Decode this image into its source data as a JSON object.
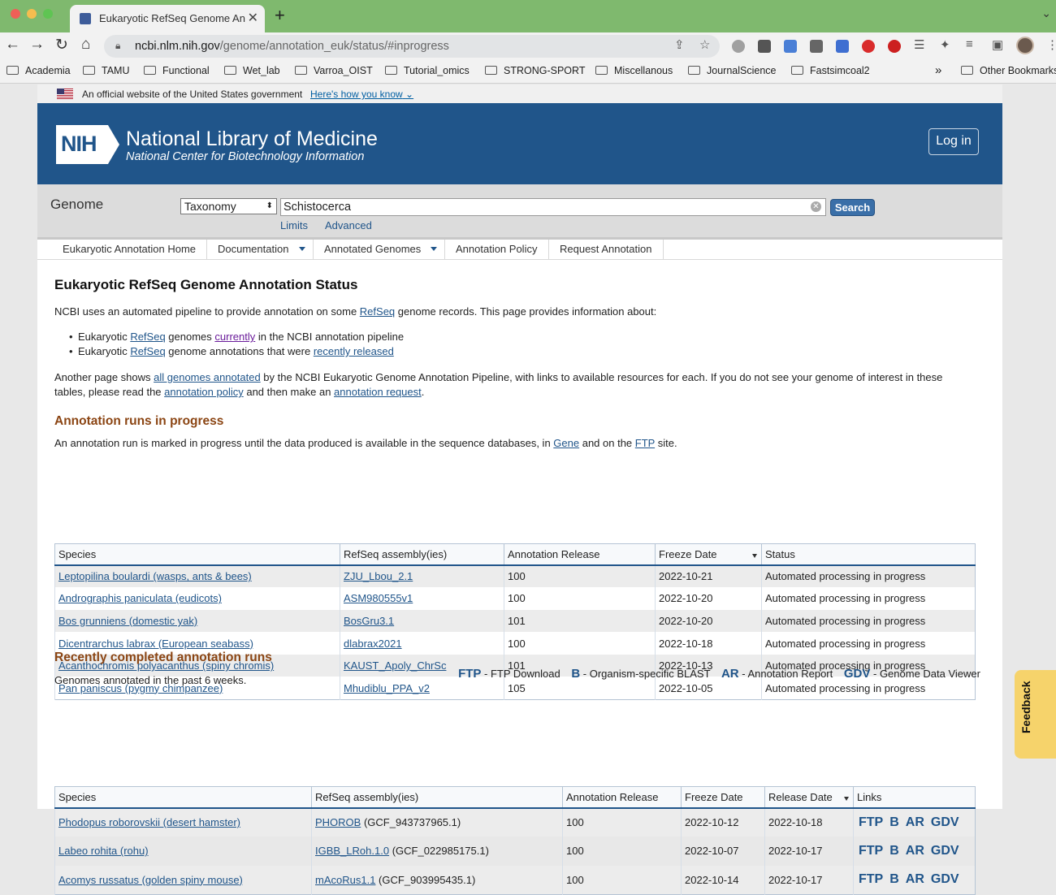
{
  "browser": {
    "tab_title": "Eukaryotic RefSeq Genome An",
    "url_host": "ncbi.nlm.nih.gov",
    "url_path": "/genome/annotation_euk/status/#inprogress",
    "bookmarks": [
      "Academia",
      "TAMU",
      "Functional",
      "Wet_lab",
      "Varroa_OIST",
      "Tutorial_omics",
      "STRONG-SPORT",
      "Miscellanous",
      "JournalScience",
      "Fastsimcoal2"
    ],
    "bookmarks_overflow": "»",
    "other_bookmarks": "Other Bookmarks"
  },
  "gov_banner": {
    "text": "An official website of the United States government",
    "link": "Here's how you know"
  },
  "header": {
    "logo": "NIH",
    "title": "National Library of Medicine",
    "subtitle": "National Center for Biotechnology Information",
    "login": "Log in"
  },
  "search": {
    "db_title": "Genome",
    "db_selected": "Taxonomy",
    "term": "Schistocerca",
    "button": "Search",
    "limits": "Limits",
    "advanced": "Advanced"
  },
  "menu": [
    "Eukaryotic Annotation Home",
    "Documentation",
    "Annotated Genomes",
    "Annotation Policy",
    "Request Annotation"
  ],
  "main": {
    "title": "Eukaryotic RefSeq Genome Annotation Status",
    "intro_a": "NCBI uses an automated pipeline to provide annotation on some ",
    "intro_link": "RefSeq",
    "intro_b": " genome records. This page provides information about:",
    "bullet1_a": "Eukaryotic ",
    "bullet1_link1": "RefSeq",
    "bullet1_b": " genomes ",
    "bullet1_link2": "currently",
    "bullet1_c": " in the NCBI annotation pipeline",
    "bullet2_a": "Eukaryotic ",
    "bullet2_link1": "RefSeq",
    "bullet2_b": " genome annotations that were ",
    "bullet2_link2": "recently released",
    "another_a": "Another page shows ",
    "another_link1": "all genomes annotated",
    "another_b": " by the NCBI Eukaryotic Genome Annotation Pipeline, with links to available resources for each. If you do not see your genome of interest in these tables, please read the ",
    "another_link2": "annotation policy",
    "another_c": " and then make an ",
    "another_link3": "annotation request",
    "another_d": "."
  },
  "inprogress": {
    "heading": "Annotation runs in progress",
    "desc_a": "An annotation run is marked in progress until the data produced is available in the sequence databases, in ",
    "desc_link1": "Gene",
    "desc_b": " and on the ",
    "desc_link2": "FTP",
    "desc_c": " site.",
    "columns": [
      "Species",
      "RefSeq assembly(ies)",
      "Annotation Release",
      "Freeze Date",
      "Status"
    ],
    "rows": [
      [
        "Leptopilina boulardi (wasps, ants & bees)",
        "ZJU_Lbou_2.1",
        "100",
        "2022-10-21",
        "Automated processing in progress"
      ],
      [
        "Andrographis paniculata (eudicots)",
        "ASM980555v1",
        "100",
        "2022-10-20",
        "Automated processing in progress"
      ],
      [
        "Bos grunniens (domestic yak)",
        "BosGru3.1",
        "101",
        "2022-10-20",
        "Automated processing in progress"
      ],
      [
        "Dicentrarchus labrax (European seabass)",
        "dlabrax2021",
        "100",
        "2022-10-18",
        "Automated processing in progress"
      ],
      [
        "Acanthochromis polyacanthus (spiny chromis)",
        "KAUST_Apoly_ChrSc",
        "101",
        "2022-10-13",
        "Automated processing in progress"
      ],
      [
        "Pan paniscus (pygmy chimpanzee)",
        "Mhudiblu_PPA_v2",
        "105",
        "2022-10-05",
        "Automated processing in progress"
      ]
    ]
  },
  "completed": {
    "heading": "Recently completed annotation runs",
    "desc": "Genomes annotated in the past 6 weeks.",
    "legend": [
      {
        "code": "FTP",
        "label": " - FTP Download"
      },
      {
        "code": "B",
        "label": " - Organism-specific BLAST"
      },
      {
        "code": "AR",
        "label": " - Annotation Report"
      },
      {
        "code": "GDV",
        "label": " - Genome Data Viewer"
      }
    ],
    "columns": [
      "Species",
      "RefSeq assembly(ies)",
      "Annotation Release",
      "Freeze Date",
      "Release Date",
      "Links"
    ],
    "rows": [
      [
        "Phodopus roborovskii (desert hamster)",
        "PHOROB",
        "(GCF_943737965.1)",
        "100",
        "2022-10-12",
        "2022-10-18"
      ],
      [
        "Labeo rohita (rohu)",
        "IGBB_LRoh.1.0",
        "(GCF_022985175.1)",
        "100",
        "2022-10-07",
        "2022-10-17"
      ],
      [
        "Acomys russatus (golden spiny mouse)",
        "mAcoRus1.1",
        "(GCF_903995435.1)",
        "100",
        "2022-10-14",
        "2022-10-17"
      ]
    ],
    "links": [
      "FTP",
      "B",
      "AR",
      "GDV"
    ]
  },
  "feedback": "Feedback"
}
